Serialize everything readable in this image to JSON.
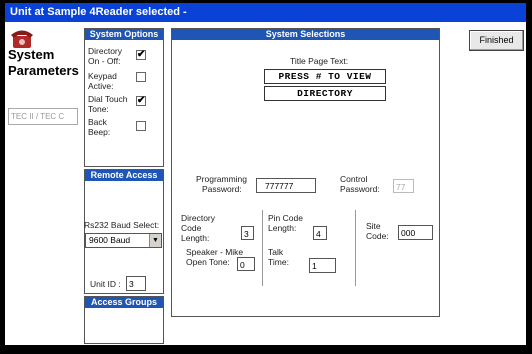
{
  "window": {
    "title": "Unit at Sample 4Reader selected -"
  },
  "header": {
    "section_title_line1": "System",
    "section_title_line2": "Parameters",
    "phone_icon": "telephone-icon",
    "device_field": "TEC II / TEC C"
  },
  "system_options": {
    "title": "System Options",
    "items": [
      {
        "label_line1": "Directory",
        "label_line2": "On - Off:",
        "checked": true,
        "mark": "✔"
      },
      {
        "label_line1": "Keypad",
        "label_line2": "Active:",
        "checked": false,
        "mark": ""
      },
      {
        "label_line1": "Dial Touch",
        "label_line2": "Tone:",
        "checked": true,
        "mark": "✔"
      },
      {
        "label_line1": "Back",
        "label_line2": "Beep:",
        "checked": false,
        "mark": ""
      }
    ]
  },
  "remote_access": {
    "title": "Remote Access",
    "baud_label": "Rs232 Baud Select:",
    "baud_value": "9600 Baud",
    "unit_id_label": "Unit ID :",
    "unit_id_value": "3"
  },
  "access_groups": {
    "title": "Access Groups"
  },
  "system_selections": {
    "title": "System Selections",
    "title_page_label": "Title Page Text:",
    "title_line1": "PRESS # TO VIEW",
    "title_line2": "DIRECTORY",
    "programming_password_label_1": "Programming",
    "programming_password_label_2": "Password:",
    "programming_password_value": "777777",
    "control_password_label_1": "Control",
    "control_password_label_2": "Password:",
    "control_password_value": "77",
    "directory_code_label_1": "Directory",
    "directory_code_label_2": "Code",
    "directory_code_label_3": "Length:",
    "directory_code_value": "3",
    "speaker_label_1": "Speaker - Mike",
    "speaker_label_2": "Open Tone:",
    "speaker_value": "0",
    "pin_code_label_1": "Pin Code",
    "pin_code_label_2": "Length:",
    "pin_code_value": "4",
    "talk_time_label_1": "Talk",
    "talk_time_label_2": "Time:",
    "talk_time_value": "1",
    "site_code_label_1": "Site",
    "site_code_label_2": "Code:",
    "site_code_value": "000"
  },
  "buttons": {
    "finished": "Finished"
  }
}
